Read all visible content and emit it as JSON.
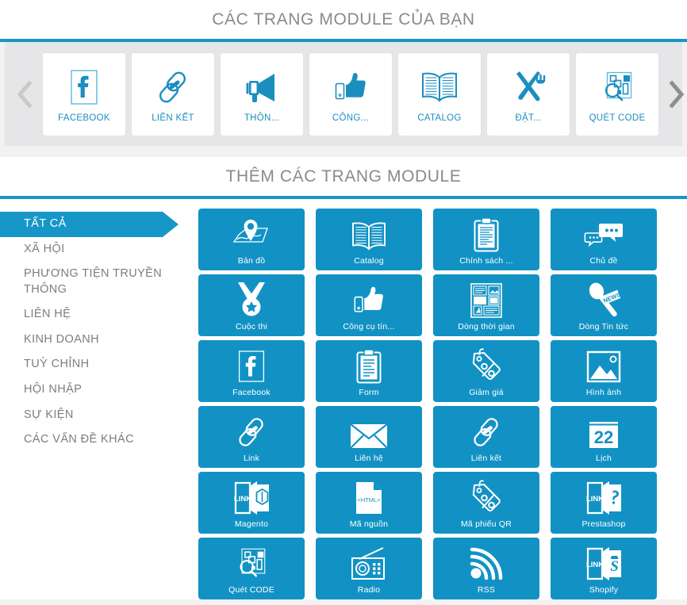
{
  "my_modules": {
    "title": "CÁC TRANG MODULE CỦA BẠN",
    "prev_arrow": "chevron-left-icon",
    "next_arrow": "chevron-right-icon",
    "accent_color": "#1797c7",
    "panel_bg": "#e6e6e8",
    "cards": [
      {
        "label": "FACEBOOK",
        "icon": "facebook-icon"
      },
      {
        "label": "LIÊN KẾT",
        "icon": "link-chain-icon"
      },
      {
        "label": "THÔN...",
        "icon": "megaphone-icon"
      },
      {
        "label": "CÔNG...",
        "icon": "thumbs-up-icon"
      },
      {
        "label": "CATALOG",
        "icon": "open-book-icon"
      },
      {
        "label": "ĐẶT...",
        "icon": "fork-knife-icon"
      },
      {
        "label": "QUÉT CODE",
        "icon": "scan-code-icon"
      }
    ]
  },
  "add_modules": {
    "title": "THÊM CÁC TRANG MODULE",
    "tile_color": "#1292c4",
    "categories": [
      {
        "label": "TẤT CẢ",
        "active": true
      },
      {
        "label": "XÃ HỘI",
        "active": false
      },
      {
        "label": "PHƯƠNG TIỆN TRUYỀN THÔNG",
        "active": false
      },
      {
        "label": "LIÊN HỆ",
        "active": false
      },
      {
        "label": "KINH DOANH",
        "active": false
      },
      {
        "label": "TUỲ CHỈNH",
        "active": false
      },
      {
        "label": "HỘI NHẬP",
        "active": false
      },
      {
        "label": "SỰ KIỆN",
        "active": false
      },
      {
        "label": "CÁC VẤN ĐỀ KHÁC",
        "active": false
      }
    ],
    "tiles": [
      {
        "label": "Bản đồ",
        "icon": "map-pin-icon"
      },
      {
        "label": "Catalog",
        "icon": "open-book-icon"
      },
      {
        "label": "Chính sách ...",
        "icon": "clipboard-icon"
      },
      {
        "label": "Chủ đề",
        "icon": "chat-bubbles-icon"
      },
      {
        "label": "Cuộc thi",
        "icon": "medal-star-icon"
      },
      {
        "label": "Công cụ tín...",
        "icon": "thumbs-up-icon"
      },
      {
        "label": "Dòng thời gian",
        "icon": "timeline-layout-icon"
      },
      {
        "label": "Dòng Tin tức",
        "icon": "news-microphone-icon"
      },
      {
        "label": "Facebook",
        "icon": "facebook-icon"
      },
      {
        "label": "Form",
        "icon": "form-clipboard-icon"
      },
      {
        "label": "Giảm giá",
        "icon": "discount-tag-icon"
      },
      {
        "label": "Hình ảnh",
        "icon": "photo-icon"
      },
      {
        "label": "Link",
        "icon": "link-chain-icon"
      },
      {
        "label": "Liên hệ",
        "icon": "envelope-icon"
      },
      {
        "label": "Liên kết",
        "icon": "link-chain-icon"
      },
      {
        "label": "Lịch",
        "icon": "calendar-icon",
        "day": "22"
      },
      {
        "label": "Magento",
        "icon": "magento-link-icon",
        "badge": "LINK"
      },
      {
        "label": "Mã nguồn",
        "icon": "html-file-icon",
        "badge": "<HTML>"
      },
      {
        "label": "Mã phiếu QR",
        "icon": "discount-tag-icon"
      },
      {
        "label": "Prestashop",
        "icon": "prestashop-link-icon",
        "badge": "LINK"
      },
      {
        "label": "Quét CODE",
        "icon": "scan-code-icon"
      },
      {
        "label": "Radio",
        "icon": "radio-icon"
      },
      {
        "label": "RSS",
        "icon": "rss-icon"
      },
      {
        "label": "Shopify",
        "icon": "shopify-link-icon",
        "badge": "LINK"
      }
    ]
  }
}
